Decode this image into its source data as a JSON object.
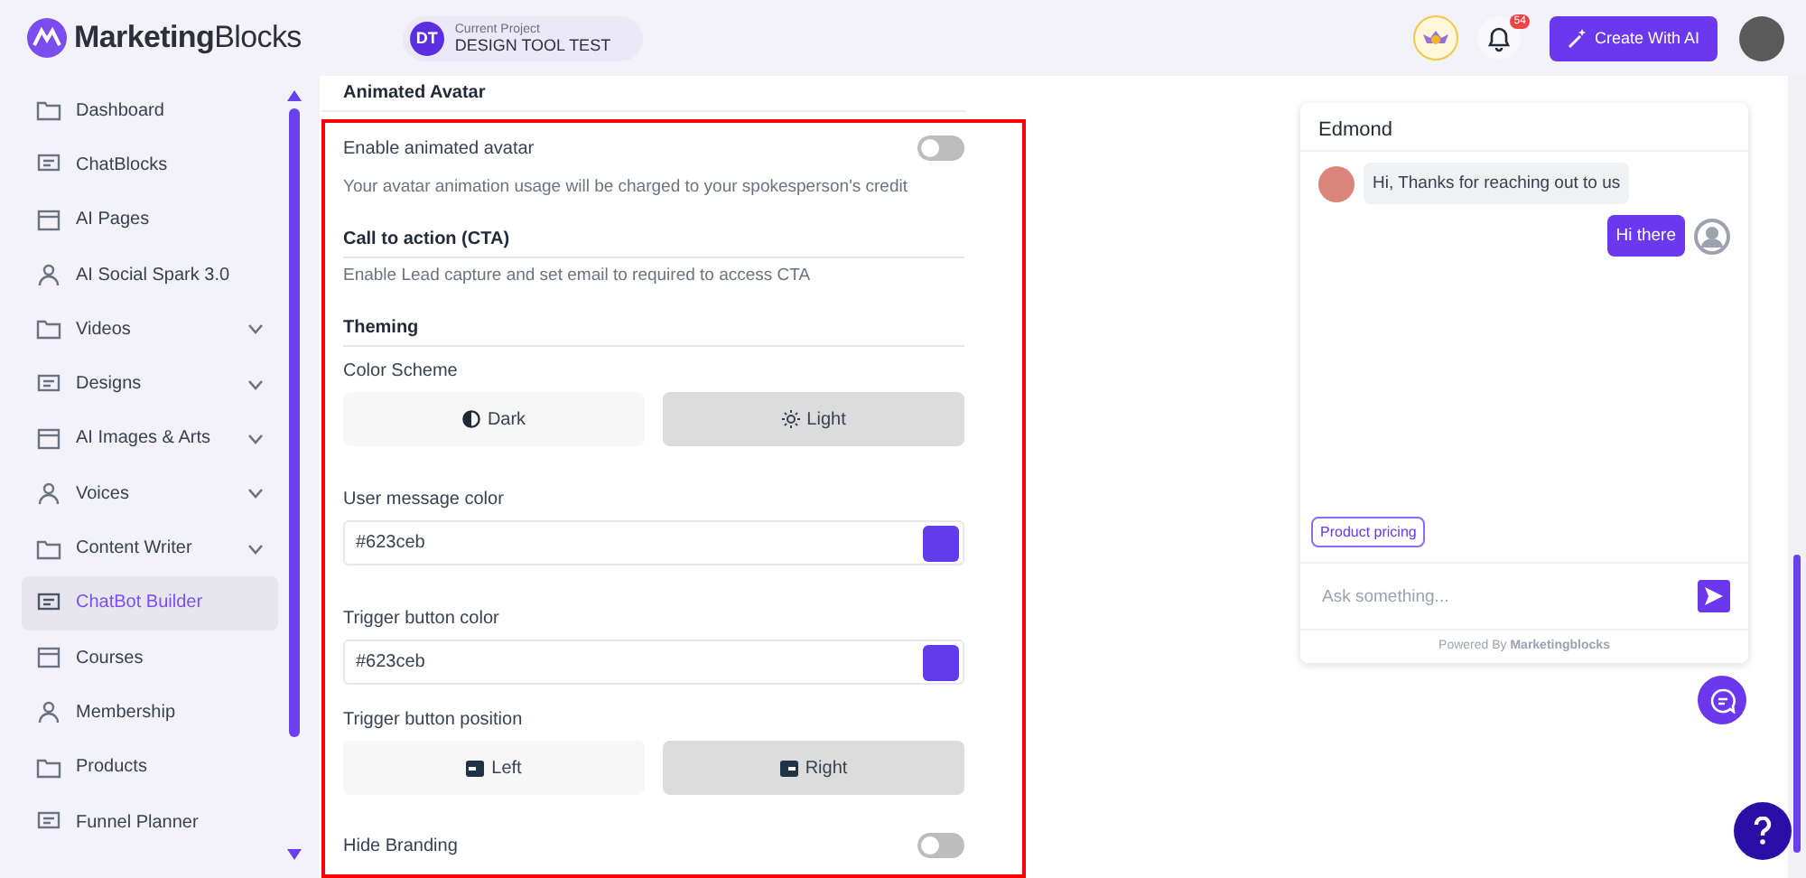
{
  "header": {
    "logo": "**Marketing**Blocks",
    "project": {
      "initials": "DT",
      "label": "Current Project",
      "name": "DESIGN TOOL TEST"
    },
    "notifications": "54",
    "create_button": "Create With AI"
  },
  "sidebar": {
    "items": [
      {
        "label": "Dashboard",
        "selected": false
      },
      {
        "label": "ChatBlocks",
        "selected": false
      },
      {
        "label": "AI Pages",
        "selected": false
      },
      {
        "label": "AI Social Spark 3.0",
        "selected": false
      },
      {
        "label": "Videos",
        "selected": false,
        "expanded": false
      },
      {
        "label": "Designs",
        "selected": false,
        "expanded": false
      },
      {
        "label": "AI Images & Arts",
        "selected": false,
        "expanded": false
      },
      {
        "label": "Voices",
        "selected": false,
        "expanded": false
      },
      {
        "label": "Content Writer",
        "selected": false,
        "expanded": false
      },
      {
        "label": "ChatBot Builder",
        "selected": true
      },
      {
        "label": "Courses",
        "selected": false
      },
      {
        "label": "Membership",
        "selected": false
      },
      {
        "label": "Products",
        "selected": false
      },
      {
        "label": "Funnel Planner",
        "selected": false
      }
    ]
  },
  "settings": {
    "heading": "Animated Avatar",
    "avatar_toggle": {
      "label": "Enable animated avatar",
      "on": false
    },
    "avatar_note": "Your avatar animation usage will be charged to your spokesperson's credit",
    "cta": {
      "heading": "Call to action (CTA)",
      "text": "Enable Lead capture and set email to required to access CTA"
    },
    "theming": {
      "heading": "Theming",
      "color_scheme": {
        "label": "Color Scheme",
        "options": [
          {
            "label": "Dark",
            "selected": false
          },
          {
            "label": "Light",
            "selected": true
          }
        ]
      },
      "user_message_color": {
        "label": "User message color",
        "value": "#623ceb",
        "color": "#623ceb"
      },
      "trigger_button_color": {
        "label": "Trigger button color",
        "value": "#623ceb",
        "color": "#623ceb"
      },
      "trigger_button_position": {
        "label": "Trigger button position",
        "options": [
          {
            "label": "Left",
            "selected": false
          },
          {
            "label": "Right",
            "selected": true
          }
        ]
      },
      "hide_branding": {
        "label": "Hide Branding",
        "on": false
      }
    }
  },
  "preview": {
    "title": "Edmond",
    "messages": [
      {
        "kind": "bot",
        "text": "Hi, Thanks for reaching out to us"
      },
      {
        "kind": "user",
        "text": "Hi there"
      }
    ],
    "suggestion": "Product pricing",
    "placeholder": "Ask something...",
    "footer": "Powered By **Marketingblocks**"
  }
}
